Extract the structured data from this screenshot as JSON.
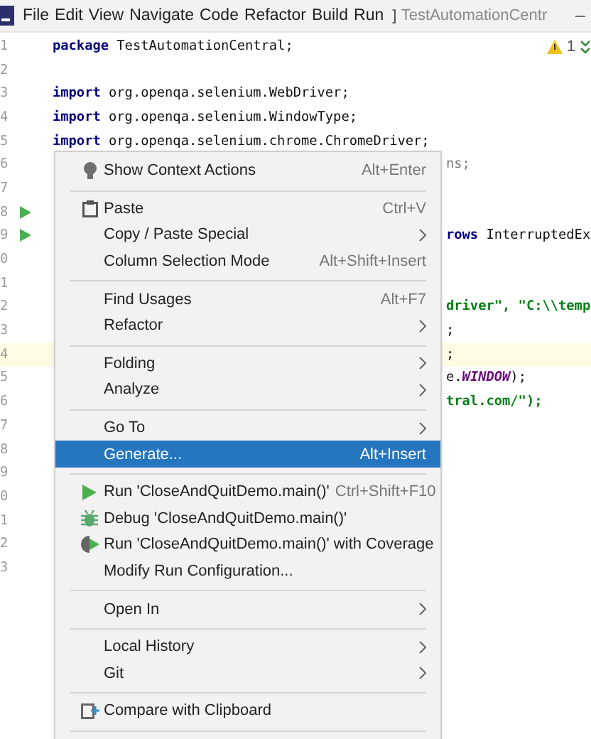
{
  "menubar": {
    "menus": [
      {
        "label": "File"
      },
      {
        "label": "Edit"
      },
      {
        "label": "View"
      },
      {
        "label": "Navigate"
      },
      {
        "label": "Code"
      },
      {
        "label": "Refactor"
      },
      {
        "label": "Build"
      },
      {
        "label": "Run"
      }
    ],
    "overflow": "]",
    "title": "TestAutomationCentr",
    "window_control": "−"
  },
  "inspections": {
    "count": "1"
  },
  "editor": {
    "lines": [
      {
        "number": "1",
        "kind": "full",
        "text": "**package** TestAutomationCentral;",
        "highlighted": false,
        "runnable": false
      },
      {
        "number": "2",
        "kind": "empty",
        "highlighted": false,
        "runnable": false
      },
      {
        "number": "3",
        "kind": "full",
        "text": "**import** org.openqa.selenium.WebDriver;",
        "highlighted": false,
        "runnable": false
      },
      {
        "number": "4",
        "kind": "full",
        "text": "**import** org.openqa.selenium.WindowType;",
        "highlighted": false,
        "runnable": false
      },
      {
        "number": "5",
        "kind": "full",
        "text": "**import** org.openqa.selenium.chrome.ChromeDriver;",
        "highlighted": false,
        "runnable": false
      },
      {
        "number": "6",
        "kind": "faded",
        "text": "ns;",
        "highlighted": false,
        "runnable": false
      },
      {
        "number": "7",
        "kind": "empty",
        "highlighted": false,
        "runnable": false
      },
      {
        "number": "8",
        "kind": "empty",
        "highlighted": false,
        "runnable": true
      },
      {
        "number": "9",
        "kind": "tail",
        "text": "**rows** InterruptedEx",
        "highlighted": false,
        "runnable": true
      },
      {
        "number": "0",
        "kind": "empty",
        "highlighted": false,
        "runnable": false
      },
      {
        "number": "1",
        "kind": "empty",
        "highlighted": false,
        "runnable": false
      },
      {
        "number": "2",
        "kind": "string",
        "text": "driver\", \"C:\\\\temp",
        "highlighted": false,
        "runnable": false
      },
      {
        "number": "3",
        "kind": "tail",
        "text": ";",
        "highlighted": false,
        "runnable": false
      },
      {
        "number": "4",
        "kind": "tail",
        "text": ";",
        "highlighted": true,
        "runnable": false
      },
      {
        "number": "5",
        "kind": "tail",
        "text": "e.*WINDOW*);",
        "highlighted": false,
        "runnable": false
      },
      {
        "number": "6",
        "kind": "string",
        "text": "tral.com/\");",
        "highlighted": false,
        "runnable": false
      },
      {
        "number": "7",
        "kind": "empty",
        "highlighted": false,
        "runnable": false
      },
      {
        "number": "8",
        "kind": "empty",
        "highlighted": false,
        "runnable": false
      },
      {
        "number": "9",
        "kind": "empty",
        "highlighted": false,
        "runnable": false
      },
      {
        "number": "0",
        "kind": "empty",
        "highlighted": false,
        "runnable": false
      },
      {
        "number": "1",
        "kind": "empty",
        "highlighted": false,
        "runnable": false
      },
      {
        "number": "2",
        "kind": "empty",
        "highlighted": false,
        "runnable": false
      },
      {
        "number": "3",
        "kind": "empty",
        "highlighted": false,
        "runnable": false
      }
    ]
  },
  "context_menu": {
    "groups": [
      {
        "items": [
          {
            "label": "Show Context Actions",
            "shortcut": "Alt+Enter",
            "kind": "bulb",
            "submenu": false,
            "selected": false
          }
        ]
      },
      {
        "items": [
          {
            "label": "Paste",
            "shortcut": "Ctrl+V",
            "kind": "clipboard",
            "submenu": false,
            "selected": false
          },
          {
            "label": "Copy / Paste Special",
            "submenu": true,
            "selected": false
          },
          {
            "label": "Column Selection Mode",
            "shortcut": "Alt+Shift+Insert",
            "submenu": false,
            "selected": false
          }
        ]
      },
      {
        "items": [
          {
            "label": "Find Usages",
            "shortcut": "Alt+F7",
            "submenu": false,
            "selected": false
          },
          {
            "label": "Refactor",
            "submenu": true,
            "selected": false
          }
        ]
      },
      {
        "items": [
          {
            "label": "Folding",
            "submenu": true,
            "selected": false
          },
          {
            "label": "Analyze",
            "submenu": true,
            "selected": false
          }
        ]
      },
      {
        "items": [
          {
            "label": "Go To",
            "submenu": true,
            "selected": false
          },
          {
            "label": "Generate...",
            "shortcut": "Alt+Insert",
            "submenu": false,
            "selected": true
          }
        ]
      },
      {
        "items": [
          {
            "label": "Run 'CloseAndQuitDemo.main()'",
            "shortcut": "Ctrl+Shift+F10",
            "kind": "run",
            "submenu": false,
            "selected": false
          },
          {
            "label": "Debug 'CloseAndQuitDemo.main()'",
            "kind": "debug",
            "submenu": false,
            "selected": false
          },
          {
            "label": "Run 'CloseAndQuitDemo.main()' with Coverage",
            "kind": "coverage",
            "submenu": false,
            "selected": false
          },
          {
            "label": "Modify Run Configuration...",
            "submenu": false,
            "selected": false
          }
        ]
      },
      {
        "items": [
          {
            "label": "Open In",
            "submenu": true,
            "selected": false
          }
        ]
      },
      {
        "items": [
          {
            "label": "Local History",
            "submenu": true,
            "selected": false
          },
          {
            "label": "Git",
            "submenu": true,
            "selected": false
          }
        ]
      },
      {
        "items": [
          {
            "label": "Compare with Clipboard",
            "kind": "compare",
            "submenu": false,
            "selected": false
          }
        ]
      }
    ]
  }
}
